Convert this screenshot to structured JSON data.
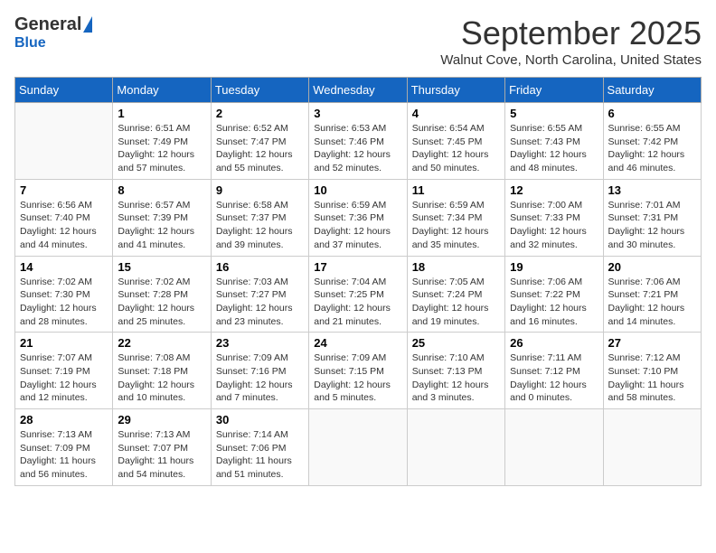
{
  "header": {
    "logo": {
      "general": "General",
      "blue": "Blue"
    },
    "month_title": "September 2025",
    "subtitle": "Walnut Cove, North Carolina, United States"
  },
  "days_of_week": [
    "Sunday",
    "Monday",
    "Tuesday",
    "Wednesday",
    "Thursday",
    "Friday",
    "Saturday"
  ],
  "weeks": [
    [
      {
        "day": "",
        "content": ""
      },
      {
        "day": "1",
        "content": "Sunrise: 6:51 AM\nSunset: 7:49 PM\nDaylight: 12 hours\nand 57 minutes."
      },
      {
        "day": "2",
        "content": "Sunrise: 6:52 AM\nSunset: 7:47 PM\nDaylight: 12 hours\nand 55 minutes."
      },
      {
        "day": "3",
        "content": "Sunrise: 6:53 AM\nSunset: 7:46 PM\nDaylight: 12 hours\nand 52 minutes."
      },
      {
        "day": "4",
        "content": "Sunrise: 6:54 AM\nSunset: 7:45 PM\nDaylight: 12 hours\nand 50 minutes."
      },
      {
        "day": "5",
        "content": "Sunrise: 6:55 AM\nSunset: 7:43 PM\nDaylight: 12 hours\nand 48 minutes."
      },
      {
        "day": "6",
        "content": "Sunrise: 6:55 AM\nSunset: 7:42 PM\nDaylight: 12 hours\nand 46 minutes."
      }
    ],
    [
      {
        "day": "7",
        "content": "Sunrise: 6:56 AM\nSunset: 7:40 PM\nDaylight: 12 hours\nand 44 minutes."
      },
      {
        "day": "8",
        "content": "Sunrise: 6:57 AM\nSunset: 7:39 PM\nDaylight: 12 hours\nand 41 minutes."
      },
      {
        "day": "9",
        "content": "Sunrise: 6:58 AM\nSunset: 7:37 PM\nDaylight: 12 hours\nand 39 minutes."
      },
      {
        "day": "10",
        "content": "Sunrise: 6:59 AM\nSunset: 7:36 PM\nDaylight: 12 hours\nand 37 minutes."
      },
      {
        "day": "11",
        "content": "Sunrise: 6:59 AM\nSunset: 7:34 PM\nDaylight: 12 hours\nand 35 minutes."
      },
      {
        "day": "12",
        "content": "Sunrise: 7:00 AM\nSunset: 7:33 PM\nDaylight: 12 hours\nand 32 minutes."
      },
      {
        "day": "13",
        "content": "Sunrise: 7:01 AM\nSunset: 7:31 PM\nDaylight: 12 hours\nand 30 minutes."
      }
    ],
    [
      {
        "day": "14",
        "content": "Sunrise: 7:02 AM\nSunset: 7:30 PM\nDaylight: 12 hours\nand 28 minutes."
      },
      {
        "day": "15",
        "content": "Sunrise: 7:02 AM\nSunset: 7:28 PM\nDaylight: 12 hours\nand 25 minutes."
      },
      {
        "day": "16",
        "content": "Sunrise: 7:03 AM\nSunset: 7:27 PM\nDaylight: 12 hours\nand 23 minutes."
      },
      {
        "day": "17",
        "content": "Sunrise: 7:04 AM\nSunset: 7:25 PM\nDaylight: 12 hours\nand 21 minutes."
      },
      {
        "day": "18",
        "content": "Sunrise: 7:05 AM\nSunset: 7:24 PM\nDaylight: 12 hours\nand 19 minutes."
      },
      {
        "day": "19",
        "content": "Sunrise: 7:06 AM\nSunset: 7:22 PM\nDaylight: 12 hours\nand 16 minutes."
      },
      {
        "day": "20",
        "content": "Sunrise: 7:06 AM\nSunset: 7:21 PM\nDaylight: 12 hours\nand 14 minutes."
      }
    ],
    [
      {
        "day": "21",
        "content": "Sunrise: 7:07 AM\nSunset: 7:19 PM\nDaylight: 12 hours\nand 12 minutes."
      },
      {
        "day": "22",
        "content": "Sunrise: 7:08 AM\nSunset: 7:18 PM\nDaylight: 12 hours\nand 10 minutes."
      },
      {
        "day": "23",
        "content": "Sunrise: 7:09 AM\nSunset: 7:16 PM\nDaylight: 12 hours\nand 7 minutes."
      },
      {
        "day": "24",
        "content": "Sunrise: 7:09 AM\nSunset: 7:15 PM\nDaylight: 12 hours\nand 5 minutes."
      },
      {
        "day": "25",
        "content": "Sunrise: 7:10 AM\nSunset: 7:13 PM\nDaylight: 12 hours\nand 3 minutes."
      },
      {
        "day": "26",
        "content": "Sunrise: 7:11 AM\nSunset: 7:12 PM\nDaylight: 12 hours\nand 0 minutes."
      },
      {
        "day": "27",
        "content": "Sunrise: 7:12 AM\nSunset: 7:10 PM\nDaylight: 11 hours\nand 58 minutes."
      }
    ],
    [
      {
        "day": "28",
        "content": "Sunrise: 7:13 AM\nSunset: 7:09 PM\nDaylight: 11 hours\nand 56 minutes."
      },
      {
        "day": "29",
        "content": "Sunrise: 7:13 AM\nSunset: 7:07 PM\nDaylight: 11 hours\nand 54 minutes."
      },
      {
        "day": "30",
        "content": "Sunrise: 7:14 AM\nSunset: 7:06 PM\nDaylight: 11 hours\nand 51 minutes."
      },
      {
        "day": "",
        "content": ""
      },
      {
        "day": "",
        "content": ""
      },
      {
        "day": "",
        "content": ""
      },
      {
        "day": "",
        "content": ""
      }
    ]
  ]
}
